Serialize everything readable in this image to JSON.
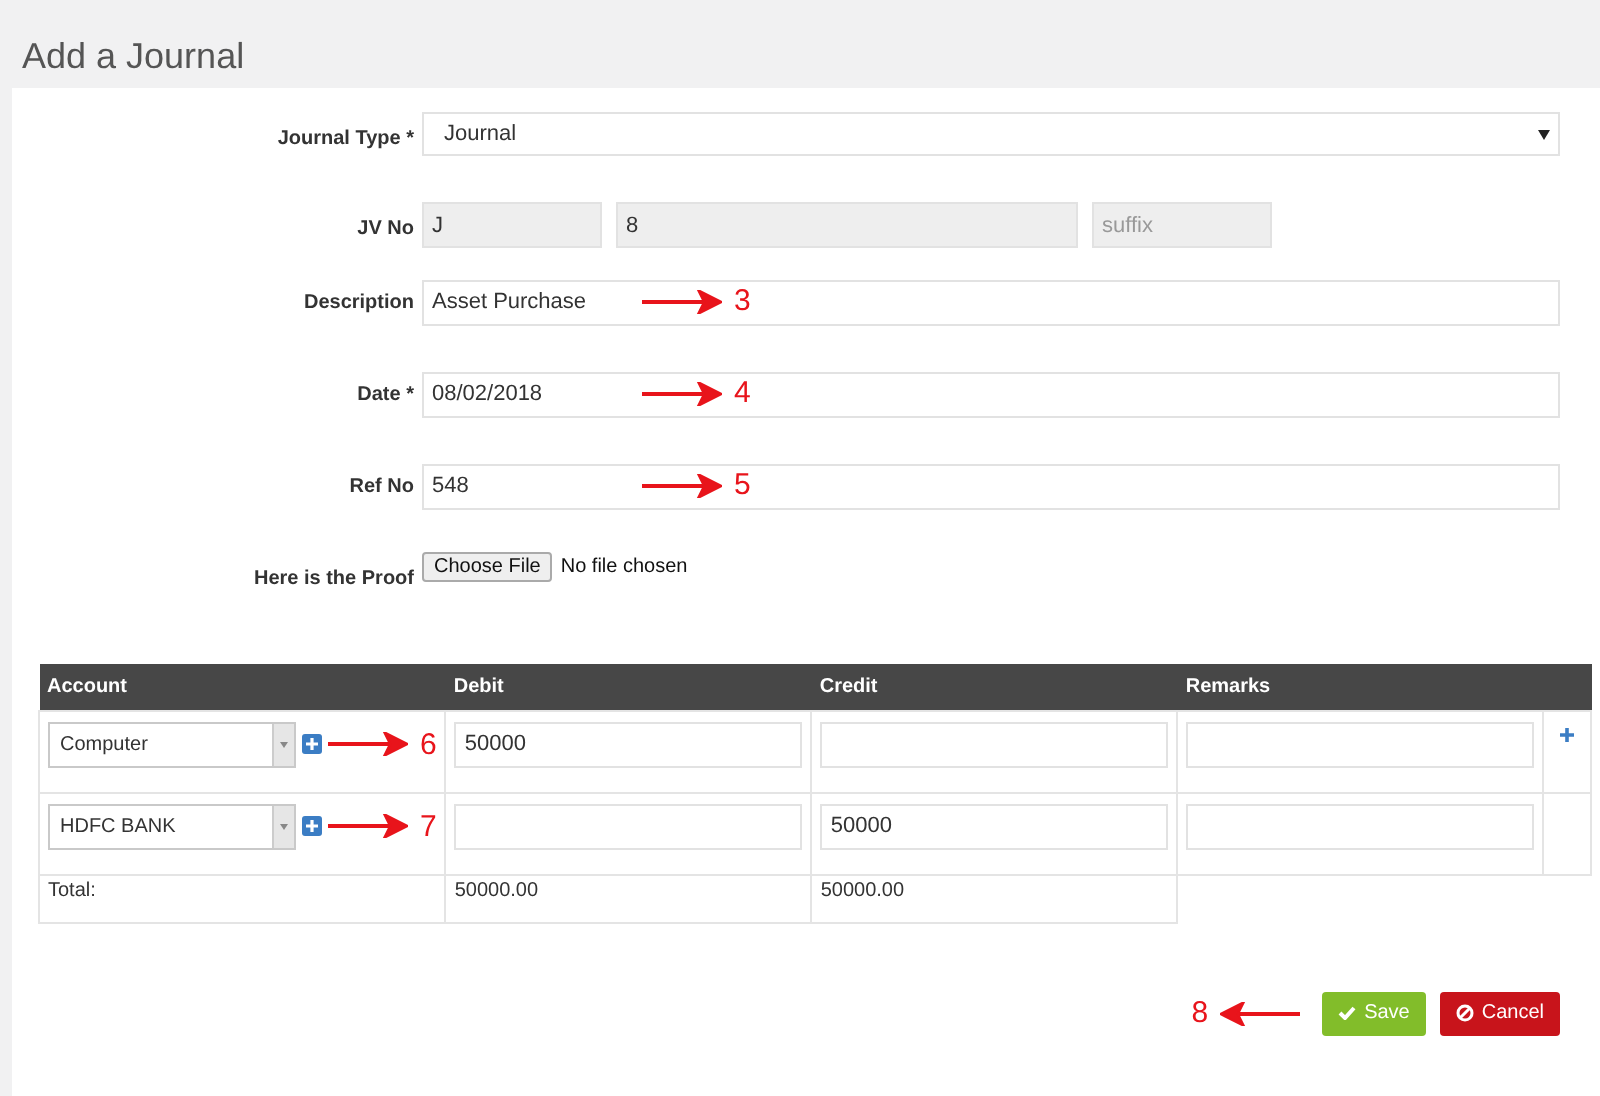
{
  "page": {
    "title": "Add a Journal"
  },
  "form": {
    "fields": [
      {
        "kind": "select",
        "label": "Journal Type *",
        "value": "Journal"
      },
      {
        "kind": "triple",
        "label": "JV No",
        "parts": [
          {
            "value": "J"
          },
          {
            "value": "8"
          },
          {
            "placeholder": "suffix"
          }
        ]
      },
      {
        "kind": "text",
        "label": "Description",
        "value": "Asset Purchase",
        "annotation": {
          "number": "3",
          "kind": "right"
        }
      },
      {
        "kind": "text",
        "label": "Date *",
        "value": "08/02/2018",
        "annotation": {
          "number": "4",
          "kind": "right"
        }
      },
      {
        "kind": "text",
        "label": "Ref No",
        "value": "548",
        "annotation": {
          "number": "5",
          "kind": "right"
        }
      },
      {
        "kind": "file",
        "label": "Here is the Proof",
        "button": "Choose File",
        "status": "No file chosen"
      }
    ]
  },
  "table": {
    "columns": [
      "Account",
      "Debit",
      "Credit",
      "Remarks"
    ],
    "rows": [
      {
        "account": "Computer",
        "debit": "50000",
        "credit": "",
        "remarks": "",
        "add_row": true,
        "annotation": {
          "number": "6",
          "kind": "right"
        }
      },
      {
        "account": "HDFC BANK",
        "debit": "",
        "credit": "50000",
        "remarks": "",
        "add_row": false,
        "annotation": {
          "number": "7",
          "kind": "right"
        }
      }
    ],
    "total": {
      "label": "Total:",
      "debit": "50000.00",
      "credit": "50000.00"
    }
  },
  "actions": {
    "save": "Save",
    "cancel": "Cancel",
    "annotation": {
      "number": "8",
      "kind": "left"
    }
  }
}
